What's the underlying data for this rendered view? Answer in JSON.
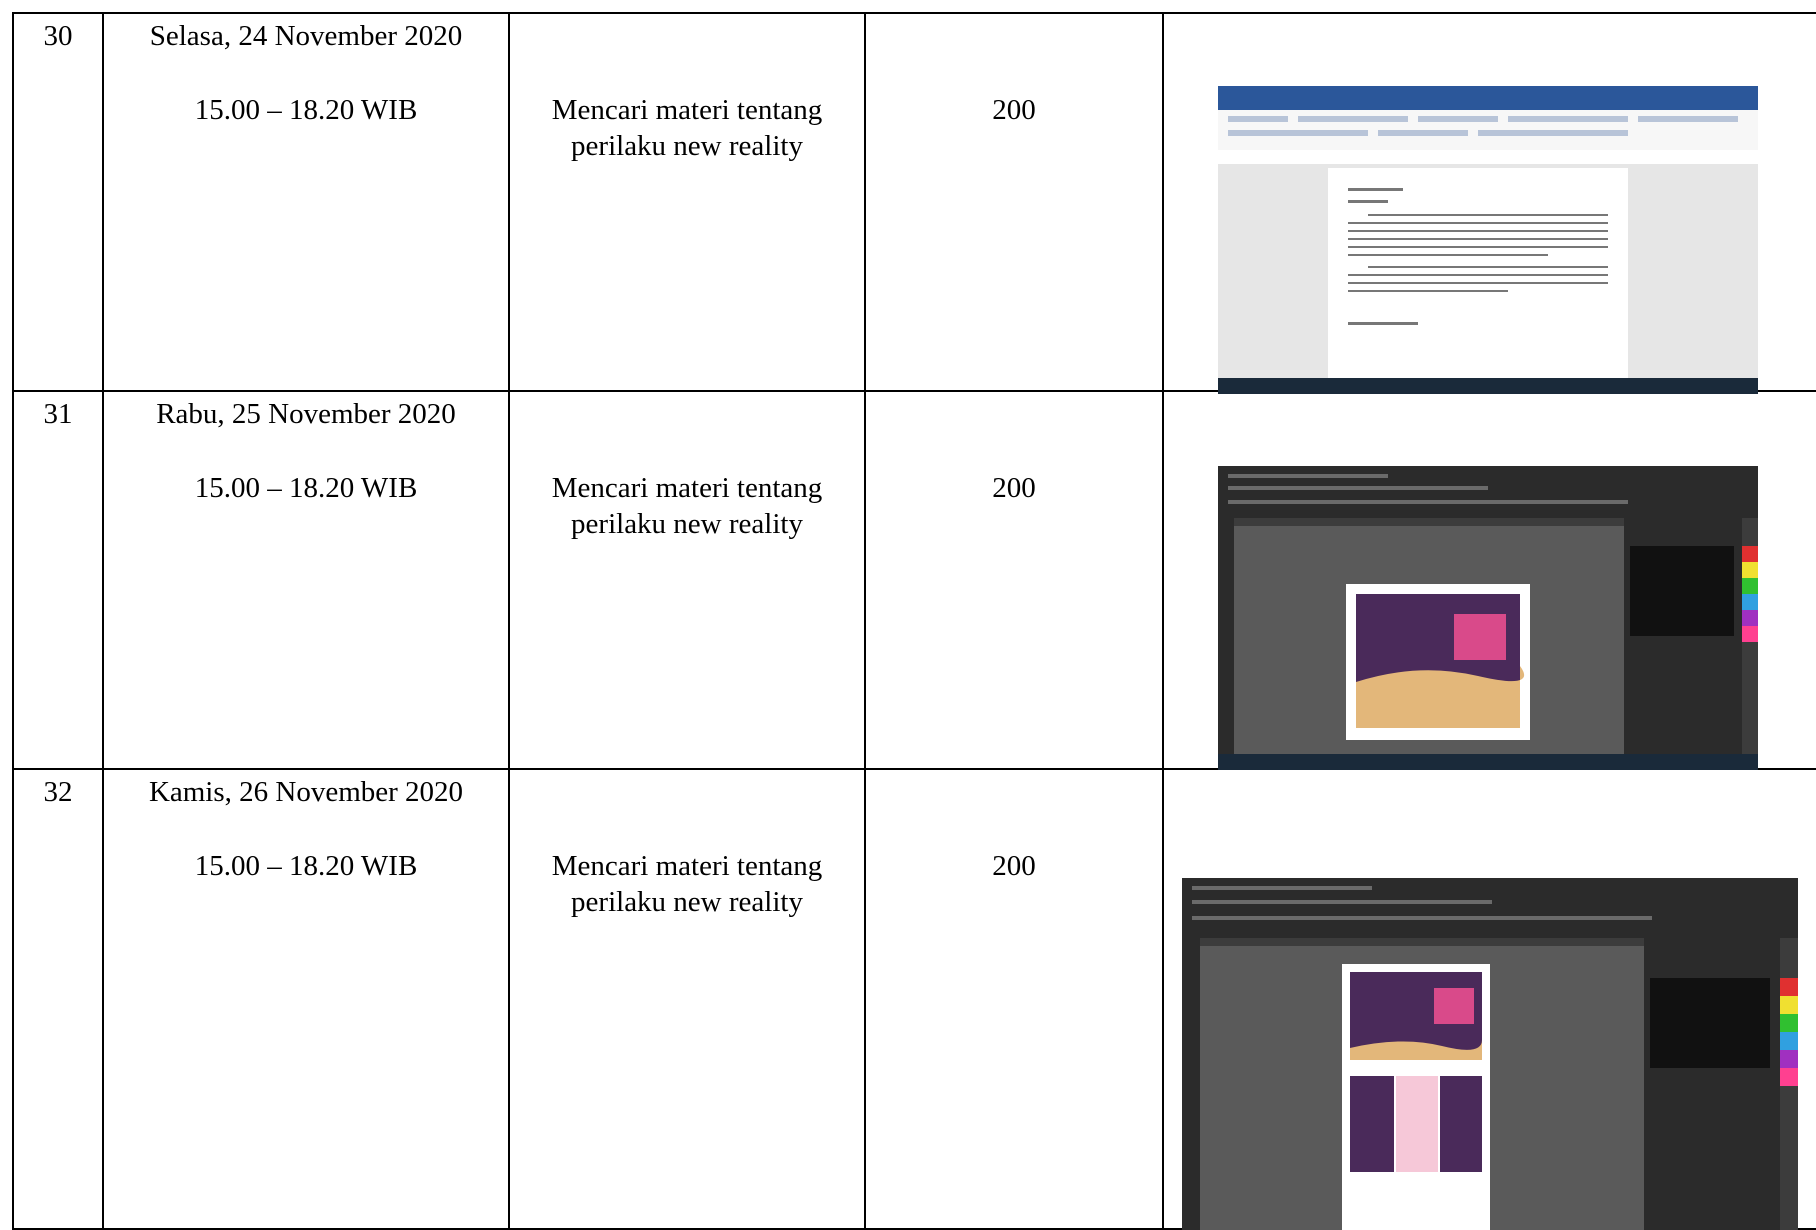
{
  "rows": [
    {
      "no": "30",
      "date": "Selasa, 24 November 2020",
      "time": "15.00 – 18.20 WIB",
      "activity": "Mencari materi tentang perilaku new reality",
      "count": "200",
      "screenshot_icon": "word-document-screenshot"
    },
    {
      "no": "31",
      "date": "Rabu, 25 November 2020",
      "time": "15.00 – 18.20 WIB",
      "activity": "Mencari materi tentang perilaku new reality",
      "count": "200",
      "screenshot_icon": "corel-brochure-screenshot"
    },
    {
      "no": "32",
      "date": "Kamis, 26 November 2020",
      "time": "15.00 – 18.20 WIB",
      "activity": "Mencari materi tentang perilaku new reality",
      "count": "200",
      "screenshot_icon": "corel-brochure-pages-screenshot"
    }
  ]
}
